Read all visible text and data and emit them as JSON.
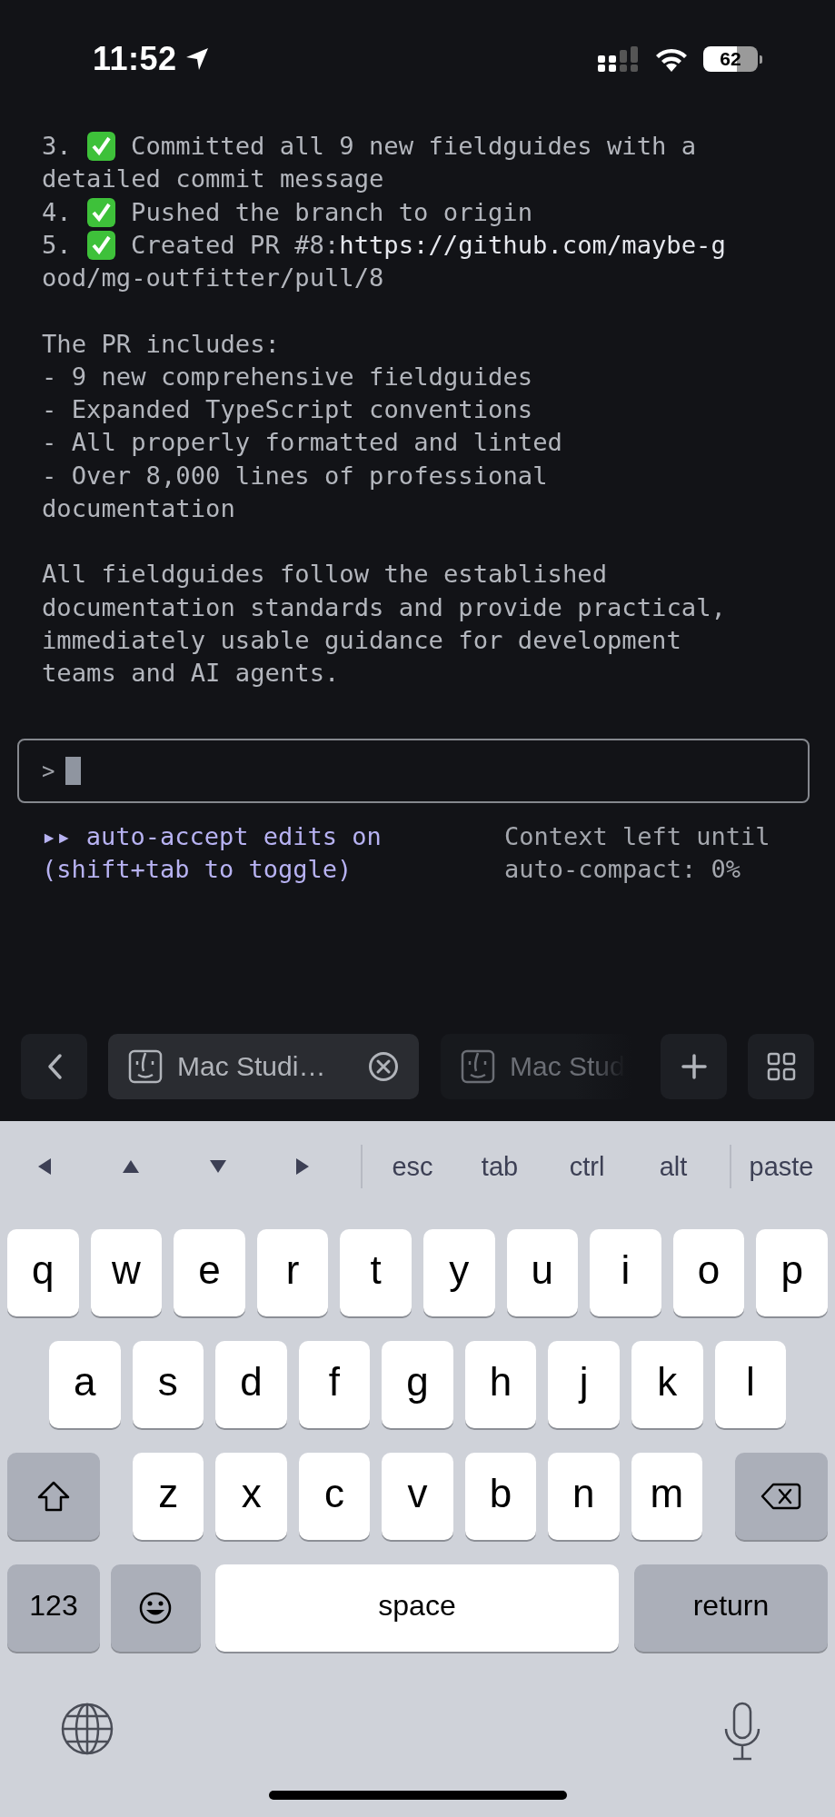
{
  "status_bar": {
    "time": "11:52",
    "battery": "62"
  },
  "terminal": {
    "rows": [
      {
        "kind": "item",
        "number": "3.",
        "done": true,
        "text": "Committed all 9 new fieldguides with a"
      },
      {
        "kind": "text",
        "text": "detailed commit message"
      },
      {
        "kind": "item",
        "number": "4.",
        "done": true,
        "text": "Pushed the branch to origin"
      },
      {
        "kind": "item",
        "number": "5.",
        "done": true,
        "text": "Created PR #8:",
        "link": "https://github.com/maybe-g"
      },
      {
        "kind": "text",
        "text": "ood/mg-outfitter/pull/8"
      },
      {
        "kind": "blank"
      },
      {
        "kind": "text",
        "text": "The PR includes:"
      },
      {
        "kind": "text",
        "text": "- 9 new comprehensive fieldguides"
      },
      {
        "kind": "text",
        "text": "- Expanded TypeScript conventions"
      },
      {
        "kind": "text",
        "text": "- All properly formatted and linted"
      },
      {
        "kind": "text",
        "text": "- Over 8,000 lines of professional"
      },
      {
        "kind": "text",
        "text": "documentation"
      },
      {
        "kind": "blank"
      },
      {
        "kind": "text",
        "text": "All fieldguides follow the established"
      },
      {
        "kind": "text",
        "text": "documentation standards and provide practical,"
      },
      {
        "kind": "text",
        "text": "immediately usable guidance for development"
      },
      {
        "kind": "text",
        "text": "teams and AI agents."
      }
    ],
    "input": {
      "prompt": ">"
    },
    "mode_hint": [
      "▸▸ auto-accept edits on",
      "(shift+tab to toggle)"
    ],
    "context_status": [
      "Context left until",
      "auto-compact: 0%"
    ]
  },
  "tabs": [
    {
      "label": "Mac Studi…",
      "selected": true,
      "closable": true
    },
    {
      "label": "Mac Stud",
      "selected": false,
      "closable": false
    }
  ],
  "keyboard": {
    "toolbar": [
      {
        "kind": "left"
      },
      {
        "kind": "up"
      },
      {
        "kind": "down"
      },
      {
        "kind": "right"
      },
      {
        "kind": "divider"
      },
      {
        "kind": "key",
        "label": "esc"
      },
      {
        "kind": "key",
        "label": "tab"
      },
      {
        "kind": "key",
        "label": "ctrl"
      },
      {
        "kind": "key",
        "label": "alt"
      },
      {
        "kind": "divider"
      },
      {
        "kind": "key",
        "label": "paste"
      }
    ],
    "rows": [
      [
        {
          "kind": "letter",
          "label": "q"
        },
        {
          "kind": "letter",
          "label": "w"
        },
        {
          "kind": "letter",
          "label": "e"
        },
        {
          "kind": "letter",
          "label": "r"
        },
        {
          "kind": "letter",
          "label": "t"
        },
        {
          "kind": "letter",
          "label": "y"
        },
        {
          "kind": "letter",
          "label": "u"
        },
        {
          "kind": "letter",
          "label": "i"
        },
        {
          "kind": "letter",
          "label": "o"
        },
        {
          "kind": "letter",
          "label": "p"
        }
      ],
      [
        {
          "kind": "letter",
          "label": "a"
        },
        {
          "kind": "letter",
          "label": "s"
        },
        {
          "kind": "letter",
          "label": "d"
        },
        {
          "kind": "letter",
          "label": "f"
        },
        {
          "kind": "letter",
          "label": "g"
        },
        {
          "kind": "letter",
          "label": "h"
        },
        {
          "kind": "letter",
          "label": "j"
        },
        {
          "kind": "letter",
          "label": "k"
        },
        {
          "kind": "letter",
          "label": "l"
        }
      ],
      [
        {
          "kind": "shift"
        },
        {
          "kind": "letter",
          "label": "z"
        },
        {
          "kind": "letter",
          "label": "x"
        },
        {
          "kind": "letter",
          "label": "c"
        },
        {
          "kind": "letter",
          "label": "v"
        },
        {
          "kind": "letter",
          "label": "b"
        },
        {
          "kind": "letter",
          "label": "n"
        },
        {
          "kind": "letter",
          "label": "m"
        },
        {
          "kind": "delete"
        }
      ]
    ],
    "bottom_row": [
      {
        "kind": "numbers",
        "label": "123"
      },
      {
        "kind": "emoji"
      },
      {
        "kind": "space",
        "label": "space"
      },
      {
        "kind": "return",
        "label": "return"
      }
    ]
  }
}
